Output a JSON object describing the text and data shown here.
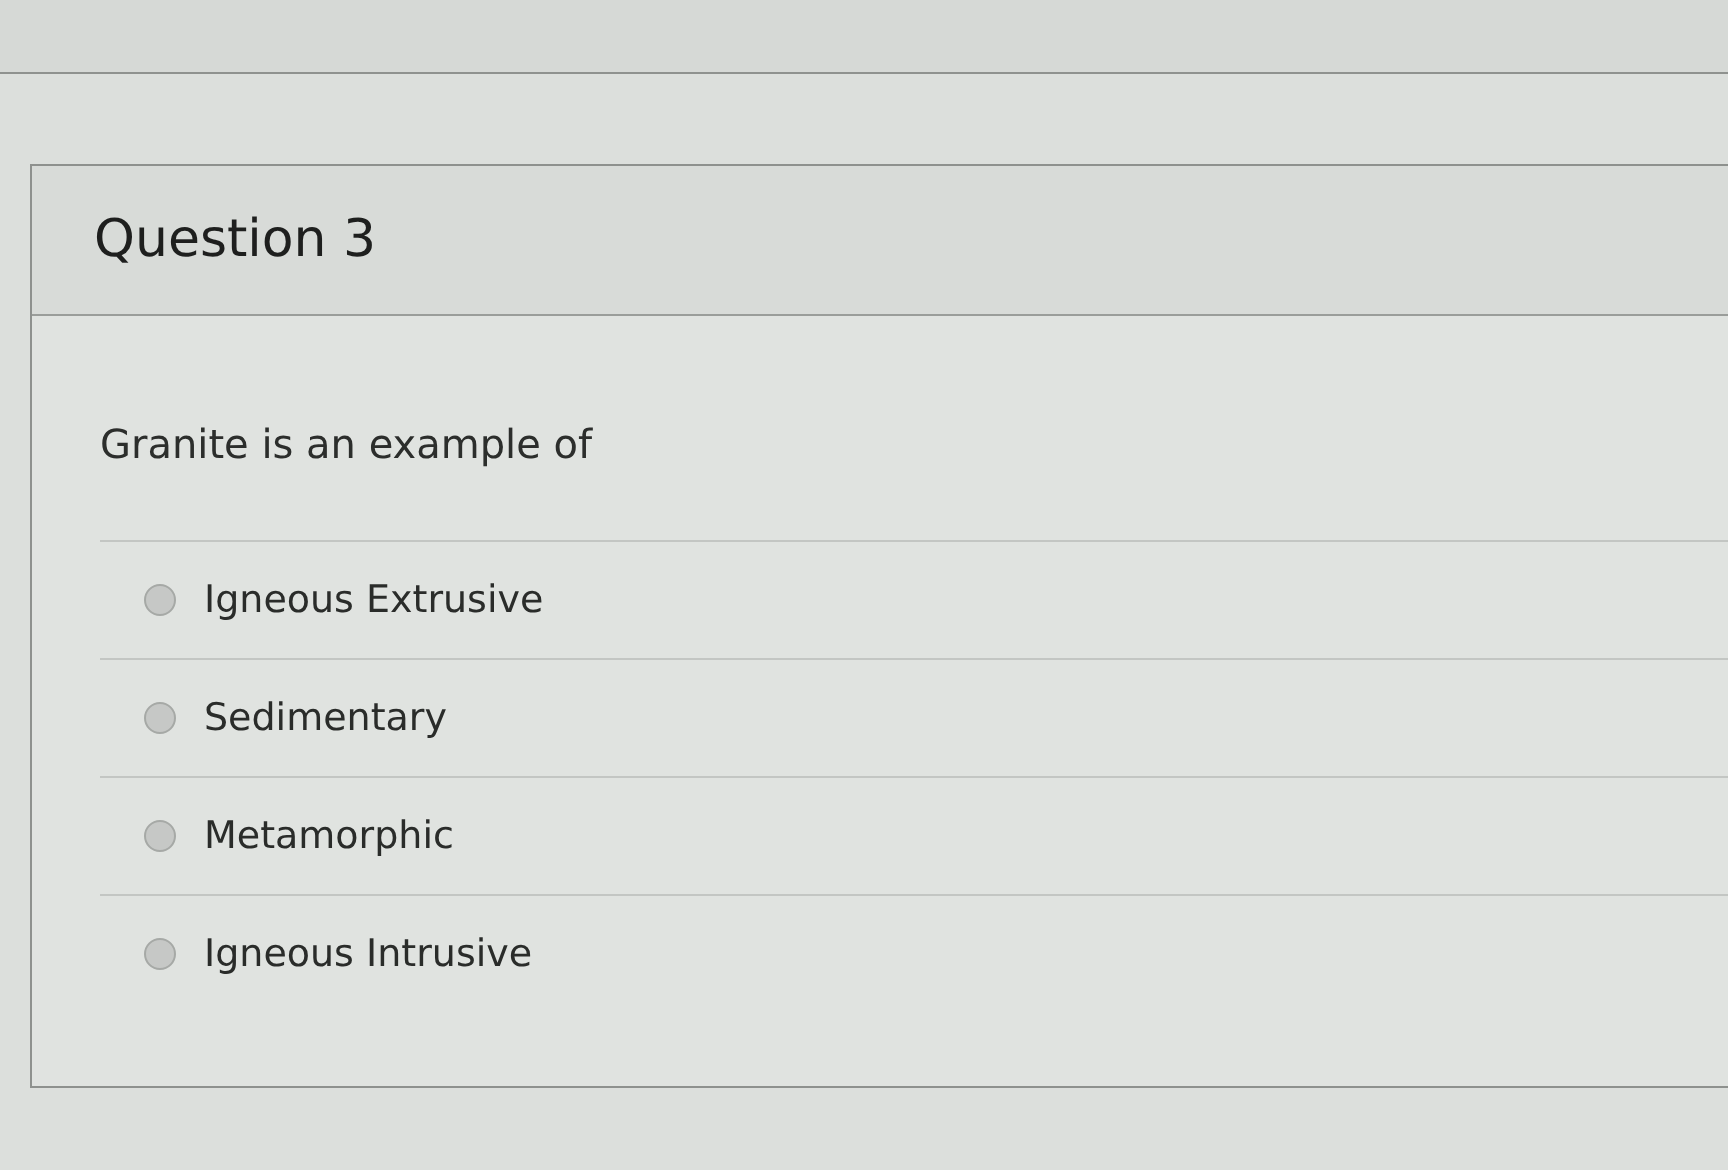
{
  "question": {
    "title": "Question 3",
    "prompt": "Granite is an example of",
    "options": [
      {
        "label": "Igneous Extrusive",
        "selected": false
      },
      {
        "label": "Sedimentary",
        "selected": false
      },
      {
        "label": "Metamorphic",
        "selected": false
      },
      {
        "label": "Igneous Intrusive",
        "selected": false
      }
    ]
  }
}
